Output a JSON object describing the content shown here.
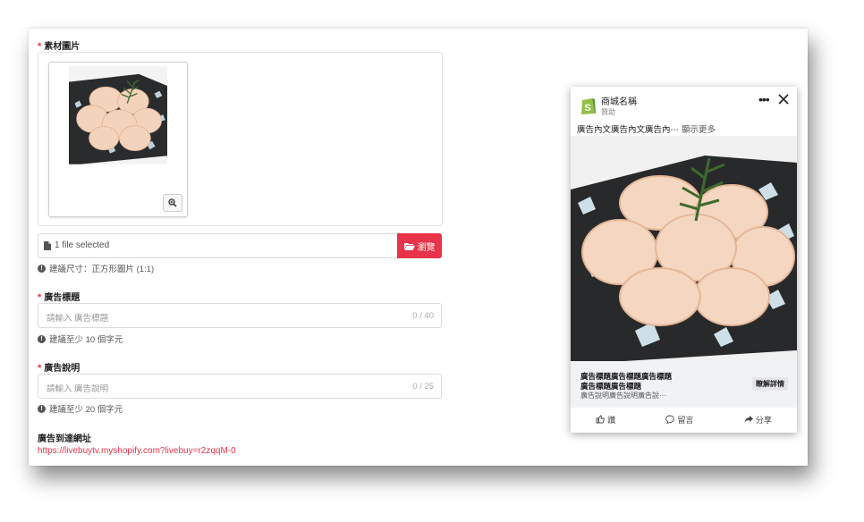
{
  "form": {
    "image_label": "素材圖片",
    "file_status": "1 file selected",
    "browse_label": "瀏覽",
    "image_hint": "建議尺寸：正方形圖片 (1:1)",
    "title_label": "廣告標題",
    "title_placeholder": "請輸入 廣告標題",
    "title_count": "0 / 40",
    "title_hint": "建議至少 10 個字元",
    "desc_label": "廣告說明",
    "desc_placeholder": "請輸入 廣告說明",
    "desc_count": "0 / 25",
    "desc_hint": "建議至少 20 個字元",
    "url_label": "廣告到達網址",
    "url_value": "https://livebuytv.myshopify.com?livebuy=r2zqqM-0",
    "required_mark": "*"
  },
  "preview": {
    "shop_name": "商城名稱",
    "sponsored": "贊助",
    "more_icon": "ellipsis-icon",
    "close_icon": "close-icon",
    "body_text": "廣告內文廣告內文廣告內⋯",
    "see_more": "顯示更多",
    "headline_1": "廣告標題廣告標題廣告標題",
    "headline_2": "廣告標題廣告標題",
    "description": "廣告說明廣告說明廣告說⋯",
    "cta_label": "瞭解詳情",
    "like_label": "讚",
    "comment_label": "留言",
    "share_label": "分享"
  },
  "colors": {
    "accent": "#e8334a",
    "shopify_green": "#95bf47"
  }
}
